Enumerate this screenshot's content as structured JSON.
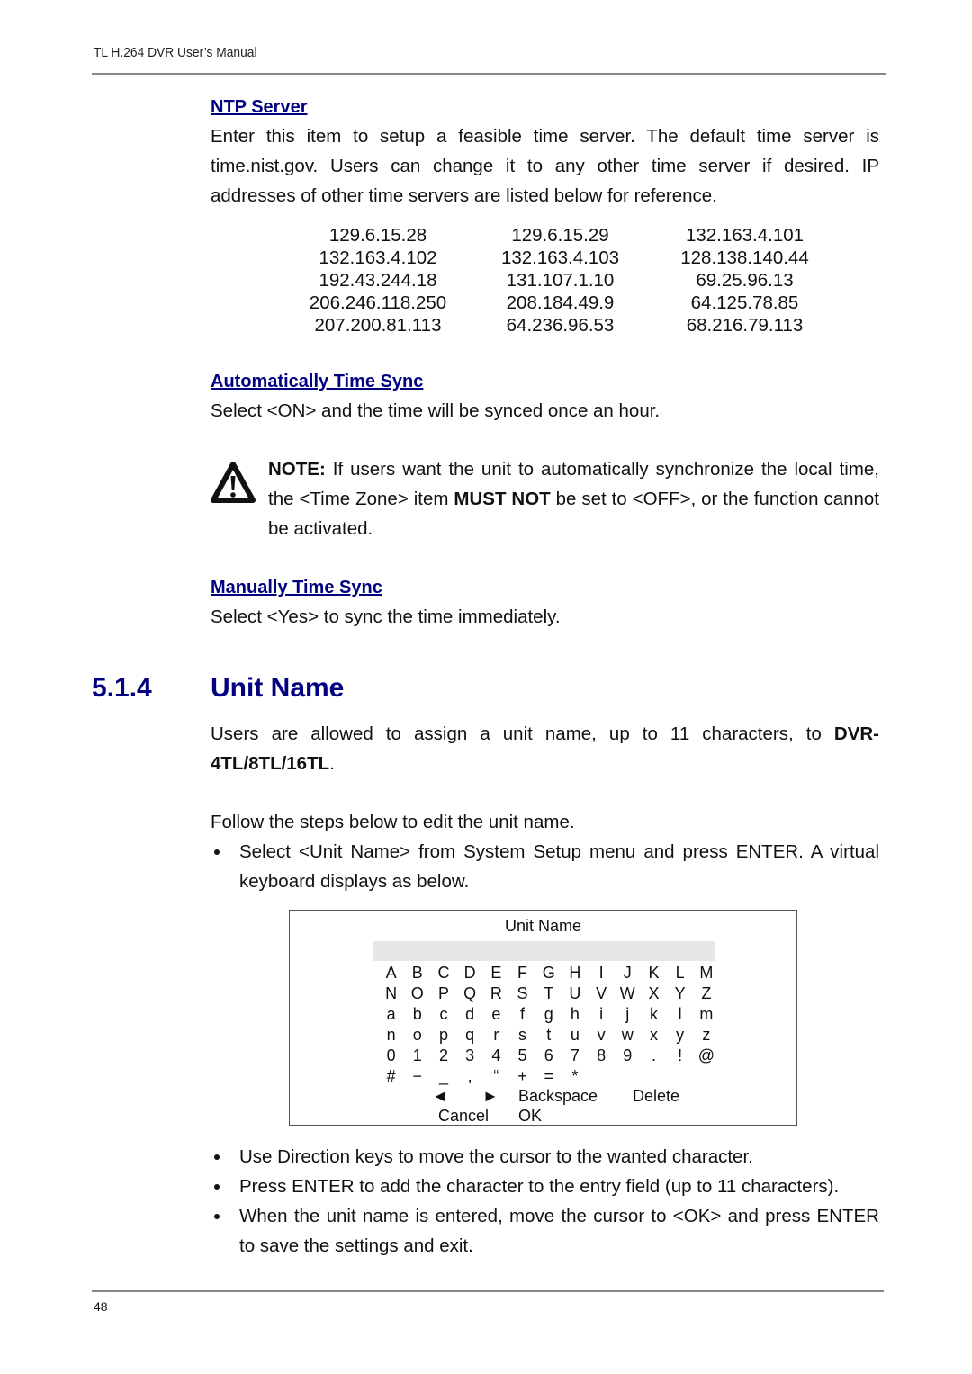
{
  "header": {
    "title": "TL H.264 DVR User’s Manual"
  },
  "ntp_server": {
    "heading": "NTP Server",
    "description": "Enter this item to setup a feasible time server. The default time server is time.nist.gov. Users can change it to any other time server if desired. IP addresses of other time servers are listed below for reference.",
    "ip_addresses": [
      [
        "129.6.15.28",
        "129.6.15.29",
        "132.163.4.101"
      ],
      [
        "132.163.4.102",
        "132.163.4.103",
        "128.138.140.44"
      ],
      [
        "192.43.244.18",
        "131.107.1.10",
        "69.25.96.13"
      ],
      [
        "206.246.118.250",
        "208.184.49.9",
        "64.125.78.85"
      ],
      [
        "207.200.81.113",
        "64.236.96.53",
        "68.216.79.113"
      ]
    ]
  },
  "auto_sync": {
    "heading": "Automatically Time Sync",
    "description": "Select <ON> and the time will be synced once an hour."
  },
  "note": {
    "icon": "warning-icon",
    "label": "NOTE:",
    "text_1": " If users want the unit to automatically synchronize the local time, the <Time Zone> item ",
    "emphasis": "MUST NOT",
    "text_2": " be set to <OFF>, or the function cannot be activated."
  },
  "manual_sync": {
    "heading": "Manually Time Sync",
    "description": "Select <Yes> to sync the time immediately."
  },
  "section": {
    "number": "5.1.4",
    "title": "Unit Name",
    "intro": "Users are allowed to assign a unit name, up to 11 characters, to ",
    "models": "DVR-4TL/8TL/16TL",
    "intro_end": ".",
    "follow": "Follow the steps below to edit the unit name.",
    "bullet_1": "Select <Unit Name> from System Setup menu and press ENTER. A virtual keyboard displays as below.",
    "steps": [
      "Use Direction keys to move the cursor to the wanted character.",
      "Press ENTER to add the character to the entry field (up to 11 characters).",
      "When the unit name is entered, move the cursor to <OK> and press ENTER to save the settings and exit."
    ]
  },
  "keyboard": {
    "title": "Unit Name",
    "entry_value": "",
    "rows": [
      [
        "A",
        "B",
        "C",
        "D",
        "E",
        "F",
        "G",
        "H",
        "I",
        "J",
        "K",
        "L",
        "M"
      ],
      [
        "N",
        "O",
        "P",
        "Q",
        "R",
        "S",
        "T",
        "U",
        "V",
        "W",
        "X",
        "Y",
        "Z"
      ],
      [
        "a",
        "b",
        "c",
        "d",
        "e",
        "f",
        "g",
        "h",
        "i",
        "j",
        "k",
        "l",
        "m"
      ],
      [
        "n",
        "o",
        "p",
        "q",
        "r",
        "s",
        "t",
        "u",
        "v",
        "w",
        "x",
        "y",
        "z"
      ],
      [
        "0",
        "1",
        "2",
        "3",
        "4",
        "5",
        "6",
        "7",
        "8",
        "9",
        ".",
        "!",
        "@"
      ],
      [
        "#",
        "−",
        "_",
        ",",
        "“",
        "+",
        "=",
        "*"
      ]
    ],
    "left_arrow": "◄",
    "right_arrow": "►",
    "backspace": "Backspace",
    "delete": "Delete",
    "cancel": "Cancel",
    "ok": "OK"
  },
  "footer": {
    "page_number": "48"
  }
}
